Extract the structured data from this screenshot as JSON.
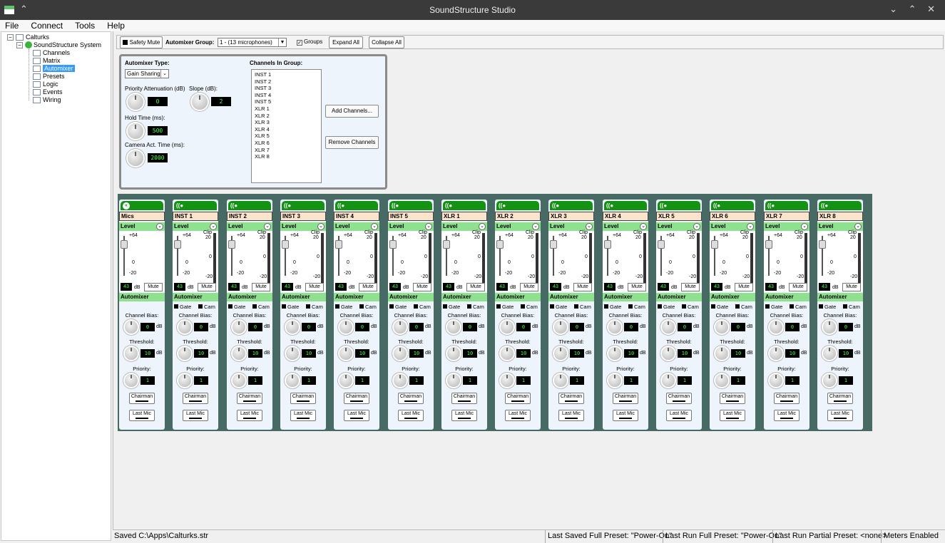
{
  "window": {
    "title": "SoundStructure Studio"
  },
  "menu": [
    "File",
    "Connect",
    "Tools",
    "Help"
  ],
  "tree": {
    "root": "Calturks",
    "system": "SoundStructure System",
    "items": [
      "Channels",
      "Matrix",
      "Automixer",
      "Presets",
      "Logic",
      "Events",
      "Wiring"
    ],
    "selected": "Automixer"
  },
  "toolbar": {
    "safety_mute": "Safety Mute",
    "group_label": "Automixer Group:",
    "group_value": "1 - (13 microphones)",
    "groups_checkbox": "Groups",
    "expand": "Expand All",
    "collapse": "Collapse All"
  },
  "automixer": {
    "type_label": "Automixer Type:",
    "type_value": "Gain Sharing",
    "priority_att_label": "Priority Attenuation (dB)",
    "priority_att_value": "0",
    "slope_label": "Slope (dB):",
    "slope_value": "2",
    "hold_label": "Hold Time (ms):",
    "hold_value": "500",
    "camera_label": "Camera Act. Time (ms):",
    "camera_value": "2000",
    "channels_label": "Channels In Group:",
    "channels": [
      "INST 1",
      "INST 2",
      "INST 3",
      "INST 4",
      "INST 5",
      "XLR 1",
      "XLR 2",
      "XLR 3",
      "XLR 4",
      "XLR 5",
      "XLR 6",
      "XLR 7",
      "XLR 8"
    ],
    "add_button": "Add Channels...",
    "remove_button": "Remove Channels"
  },
  "strip_common": {
    "level": "Level",
    "scale_top": "+64",
    "scale_mid": "0",
    "scale_bot": "-20",
    "clip": "Clip",
    "meter_top": "20",
    "meter_mid": "0",
    "meter_bot": "-20",
    "db_value": "43",
    "db_unit": "dB",
    "mute": "Mute",
    "automixer": "Automixer",
    "gate": "Gate",
    "cam": "Cam",
    "bias_label": "Channel Bias:",
    "bias_value": "0",
    "threshold_label": "Threshold:",
    "threshold_value": "10",
    "priority_label": "Priority:",
    "priority_value": "1",
    "chairman": "Chairman",
    "last_mic": "Last Mic"
  },
  "strips": [
    {
      "name": "Mics",
      "icon": "«"
    },
    {
      "name": "INST 1",
      "icon": "((●"
    },
    {
      "name": "INST 2",
      "icon": "((●"
    },
    {
      "name": "INST 3",
      "icon": "((●"
    },
    {
      "name": "INST 4",
      "icon": "((●"
    },
    {
      "name": "INST 5",
      "icon": "((●"
    },
    {
      "name": "XLR 1",
      "icon": "((●"
    },
    {
      "name": "XLR 2",
      "icon": "((●"
    },
    {
      "name": "XLR 3",
      "icon": "((●"
    },
    {
      "name": "XLR 4",
      "icon": "((●"
    },
    {
      "name": "XLR 5",
      "icon": "((●"
    },
    {
      "name": "XLR 6",
      "icon": "((●"
    },
    {
      "name": "XLR 7",
      "icon": "((●"
    },
    {
      "name": "XLR 8",
      "icon": "((●"
    }
  ],
  "status": {
    "saved": "Saved C:\\Apps\\Calturks.str",
    "last_saved": "Last Saved Full Preset: \"Power-On\"",
    "last_run_full": "Last Run Full Preset: \"Power-On\"",
    "last_run_partial": "Last Run Partial Preset: <none>",
    "meters": "Meters Enabled"
  },
  "colors": {
    "strip_header": "#139213",
    "section_green": "#8fe08f",
    "lcd_text": "#4eff4e",
    "name_bg": "#fbe4cc",
    "selection": "#3399ff"
  }
}
